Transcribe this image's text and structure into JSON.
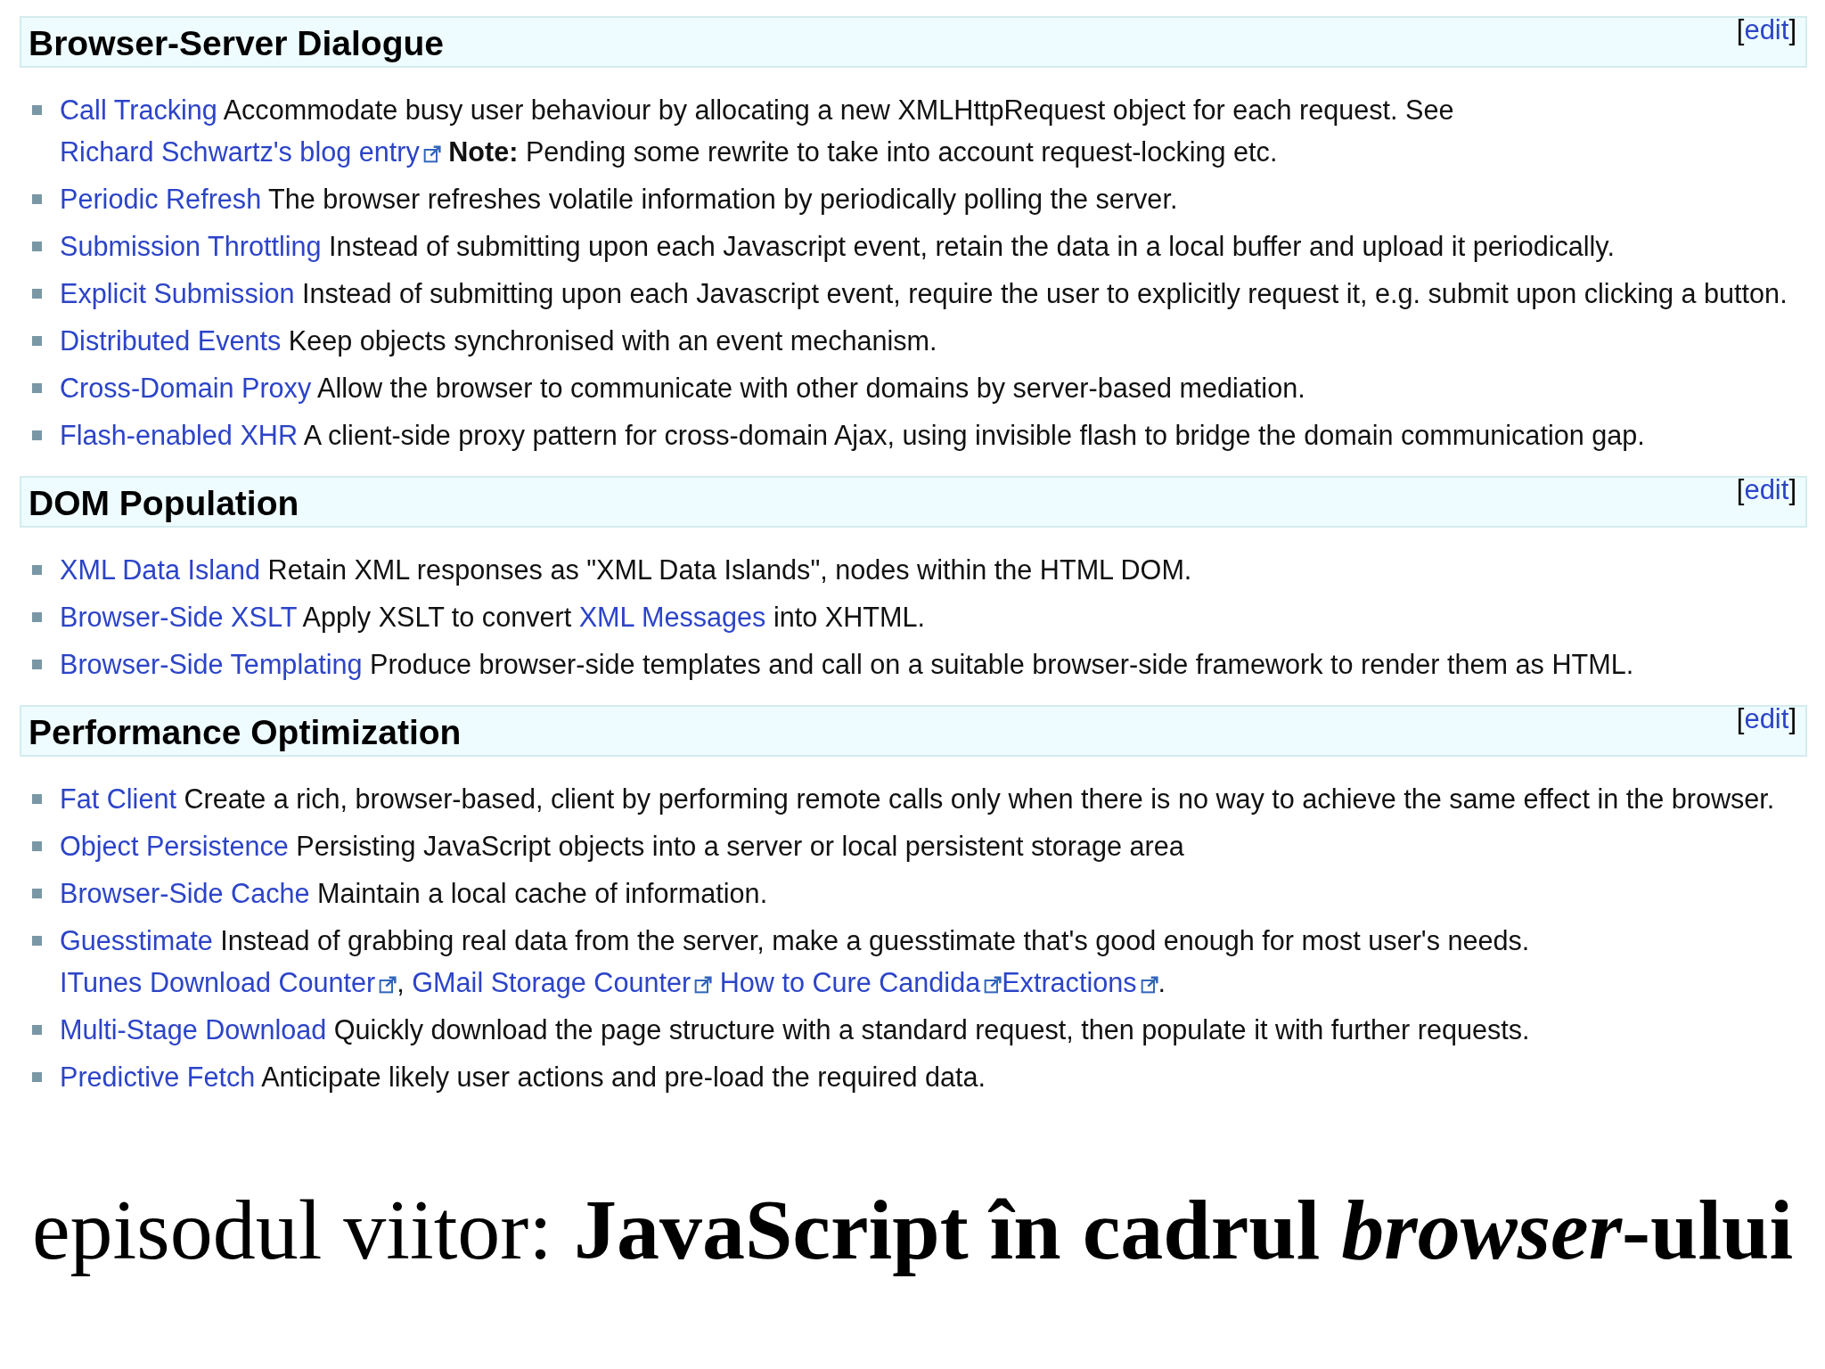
{
  "sections": [
    {
      "title": "Browser-Server Dialogue",
      "edit_open": "[",
      "edit": "edit",
      "edit_close": "]",
      "items": [
        [
          {
            "kind": "link",
            "text": "Call Tracking"
          },
          {
            "kind": "text",
            "text": " Accommodate busy user behaviour by allocating a new XMLHttpRequest object for each request. See "
          },
          {
            "kind": "external",
            "text": "Richard Schwartz's blog entry"
          },
          {
            "kind": "bold",
            "text": "Note:",
            "space_before": true
          },
          {
            "kind": "text",
            "text": " Pending some rewrite to take into account request-locking etc."
          }
        ],
        [
          {
            "kind": "link",
            "text": "Periodic Refresh"
          },
          {
            "kind": "text",
            "text": " The browser refreshes volatile information by periodically polling the server."
          }
        ],
        [
          {
            "kind": "link",
            "text": "Submission Throttling"
          },
          {
            "kind": "text",
            "text": " Instead of submitting upon each Javascript event, retain the data in a local buffer and upload it periodically."
          }
        ],
        [
          {
            "kind": "link",
            "text": "Explicit Submission"
          },
          {
            "kind": "text",
            "text": " Instead of submitting upon each Javascript event, require the user to explicitly request it, e.g. submit upon clicking a button."
          }
        ],
        [
          {
            "kind": "link",
            "text": "Distributed Events"
          },
          {
            "kind": "text",
            "text": " Keep objects synchronised with an event mechanism."
          }
        ],
        [
          {
            "kind": "link",
            "text": "Cross-Domain Proxy"
          },
          {
            "kind": "text",
            "text": " Allow the browser to communicate with other domains by server-based mediation."
          }
        ],
        [
          {
            "kind": "link",
            "text": "Flash-enabled XHR"
          },
          {
            "kind": "text",
            "text": " A client-side proxy pattern for cross-domain Ajax, using invisible flash to bridge the domain communication gap."
          }
        ]
      ]
    },
    {
      "title": "DOM Population",
      "edit_open": "[",
      "edit": "edit",
      "edit_close": "]",
      "items": [
        [
          {
            "kind": "link",
            "text": "XML Data Island"
          },
          {
            "kind": "text",
            "text": " Retain XML responses as \"XML Data Islands\", nodes within the HTML DOM."
          }
        ],
        [
          {
            "kind": "link",
            "text": "Browser-Side XSLT"
          },
          {
            "kind": "text",
            "text": " Apply XSLT to convert "
          },
          {
            "kind": "link",
            "text": "XML Messages"
          },
          {
            "kind": "text",
            "text": " into XHTML."
          }
        ],
        [
          {
            "kind": "link",
            "text": "Browser-Side Templating"
          },
          {
            "kind": "text",
            "text": " Produce browser-side templates and call on a suitable browser-side framework to render them as HTML."
          }
        ]
      ]
    },
    {
      "title": "Performance Optimization",
      "edit_open": "[",
      "edit": "edit",
      "edit_close": "]",
      "items": [
        [
          {
            "kind": "link",
            "text": "Fat Client"
          },
          {
            "kind": "text",
            "text": " Create a rich, browser-based, client by performing remote calls only when there is no way to achieve the same effect in the browser."
          }
        ],
        [
          {
            "kind": "link",
            "text": "Object Persistence"
          },
          {
            "kind": "text",
            "text": " Persisting JavaScript objects into a server or local persistent storage area"
          }
        ],
        [
          {
            "kind": "link",
            "text": "Browser-Side Cache"
          },
          {
            "kind": "text",
            "text": " Maintain a local cache of information."
          }
        ],
        [
          {
            "kind": "link",
            "text": "Guesstimate"
          },
          {
            "kind": "text",
            "text": " Instead of grabbing real data from the server, make a guesstimate that's good enough for most user's needs. "
          },
          {
            "kind": "external",
            "text": "ITunes Download Counter"
          },
          {
            "kind": "text",
            "text": ", "
          },
          {
            "kind": "external",
            "text": "GMail Storage Counter"
          },
          {
            "kind": "external",
            "text": "How to Cure Candida",
            "space_before": true
          },
          {
            "kind": "external",
            "text": "Extractions"
          },
          {
            "kind": "text",
            "text": "."
          }
        ],
        [
          {
            "kind": "link",
            "text": "Multi-Stage Download"
          },
          {
            "kind": "text",
            "text": " Quickly download the page structure with a standard request, then populate it with further requests."
          }
        ],
        [
          {
            "kind": "link",
            "text": "Predictive Fetch"
          },
          {
            "kind": "text",
            "text": " Anticipate likely user actions and pre-load the required data."
          }
        ]
      ]
    }
  ],
  "footer": [
    {
      "kind": "plain",
      "text": "episodul viitor: "
    },
    {
      "kind": "bold",
      "text": "JavaScript în cadrul "
    },
    {
      "kind": "bolditalic",
      "text": "browser"
    },
    {
      "kind": "bold",
      "text": "-ului"
    }
  ]
}
